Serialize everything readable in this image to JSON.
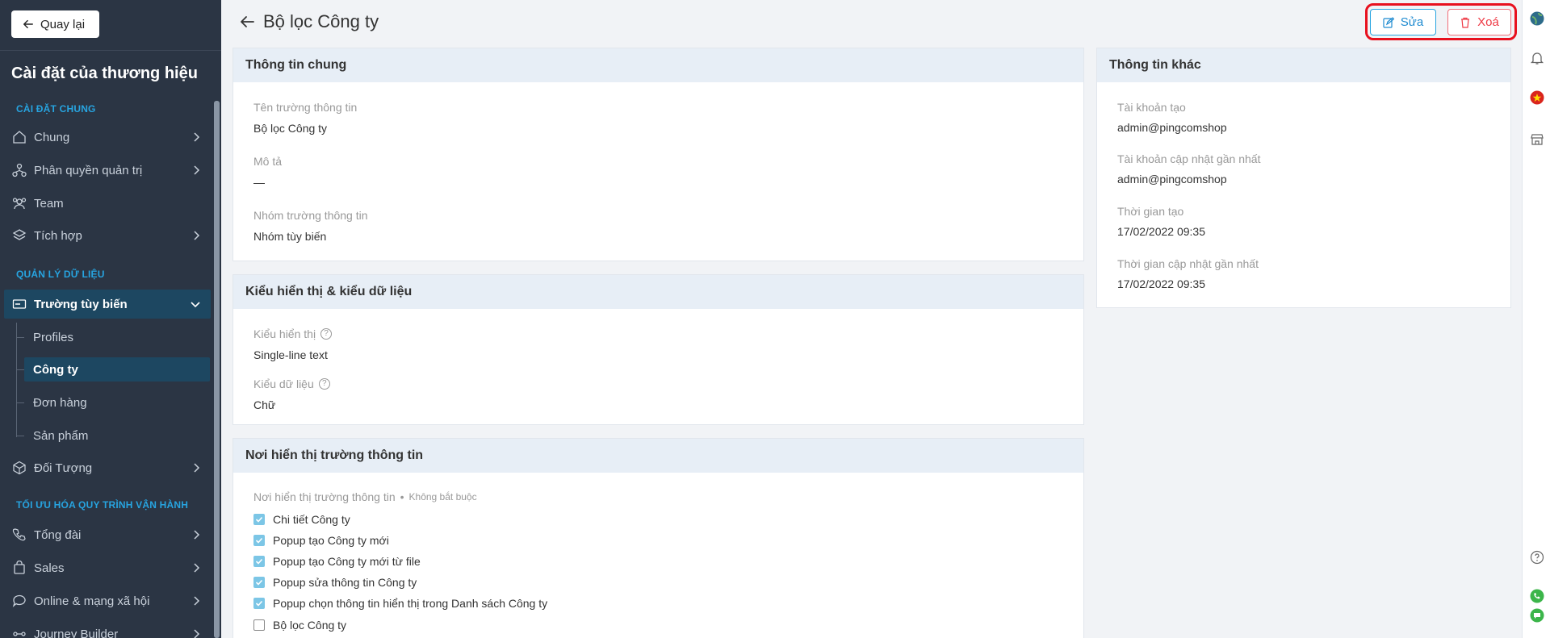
{
  "nav": {
    "back_label": "Quay lại"
  },
  "sidebar": {
    "title": "Cài đặt của thương hiệu",
    "sections": [
      {
        "label": "CÀI ĐẶT CHUNG"
      },
      {
        "label": "QUẢN LÝ DỮ LIỆU"
      },
      {
        "label": "TỐI ƯU HÓA QUY TRÌNH VẬN HÀNH"
      }
    ],
    "items": [
      {
        "label": "Chung",
        "icon": "home-icon"
      },
      {
        "label": "Phân quyền quản trị",
        "icon": "org-chart-icon"
      },
      {
        "label": "Team",
        "icon": "team-icon"
      },
      {
        "label": "Tích hợp",
        "icon": "layers-icon"
      },
      {
        "label": "Trường tùy biến",
        "icon": "custom-field-icon"
      },
      {
        "label": "Đối Tượng",
        "icon": "cube-icon"
      },
      {
        "label": "Tổng đài",
        "icon": "phone-icon"
      },
      {
        "label": "Sales",
        "icon": "bag-icon"
      },
      {
        "label": "Online & mạng xã hội",
        "icon": "chat-icon"
      },
      {
        "label": "Journey Builder",
        "icon": "journey-icon"
      }
    ],
    "sub_items": [
      {
        "label": "Profiles"
      },
      {
        "label": "Công ty"
      },
      {
        "label": "Đơn hàng"
      },
      {
        "label": "Sản phẩm"
      }
    ]
  },
  "header": {
    "title": "Bộ lọc Công ty",
    "edit_label": "Sửa",
    "delete_label": "Xoá"
  },
  "general": {
    "title": "Thông tin chung",
    "name_label": "Tên trường thông tin",
    "name_value": "Bộ lọc Công ty",
    "desc_label": "Mô tả",
    "desc_value": "—",
    "group_label": "Nhóm trường thông tin",
    "group_value": "Nhóm tùy biến"
  },
  "display": {
    "title": "Kiểu hiển thị & kiểu dữ liệu",
    "display_label": "Kiểu hiển thị",
    "display_value": "Single-line text",
    "data_label": "Kiểu dữ liệu",
    "data_value": "Chữ"
  },
  "placement": {
    "title": "Nơi hiển thị trường thông tin",
    "label": "Nơi hiển thị trường thông tin",
    "optional_note": "Không bắt buộc",
    "options": [
      {
        "label": "Chi tiết Công ty",
        "checked": true
      },
      {
        "label": "Popup tạo Công ty mới",
        "checked": true
      },
      {
        "label": "Popup tạo Công ty mới từ file",
        "checked": true
      },
      {
        "label": "Popup sửa thông tin Công ty",
        "checked": true
      },
      {
        "label": "Popup chọn thông tin hiển thị trong Danh sách Công ty",
        "checked": true
      },
      {
        "label": "Bộ lọc Công ty",
        "checked": false
      }
    ]
  },
  "other": {
    "title": "Thông tin khác",
    "created_by_label": "Tài khoản tạo",
    "created_by_value": "admin@pingcomshop",
    "updated_by_label": "Tài khoản cập nhật gần nhất",
    "updated_by_value": "admin@pingcomshop",
    "created_at_label": "Thời gian tạo",
    "created_at_value": "17/02/2022 09:35",
    "updated_at_label": "Thời gian cập nhật gần nhất",
    "updated_at_value": "17/02/2022 09:35"
  },
  "colors": {
    "sidebar_bg": "#2b3544",
    "accent": "#27a4e0",
    "active_bg": "#1d4761",
    "danger": "#ee3944",
    "highlight": "#e8101e"
  },
  "rail": {
    "icons": [
      "globe-avatar-icon",
      "bell-icon",
      "vietnam-flag-icon",
      "store-icon",
      "help-icon",
      "phone-call-icon",
      "message-icon"
    ]
  }
}
